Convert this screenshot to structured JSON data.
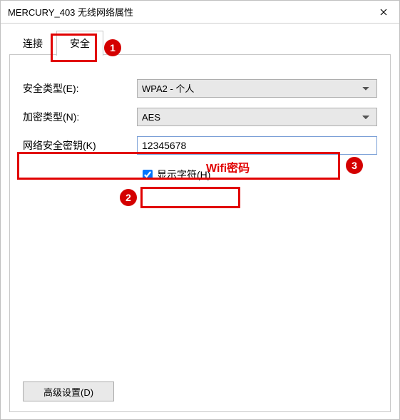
{
  "titlebar": {
    "title": "MERCURY_403 无线网络属性"
  },
  "tabs": {
    "connect": "连接",
    "security": "安全"
  },
  "form": {
    "security_type_label": "安全类型(E):",
    "security_type_value": "WPA2 - 个人",
    "encryption_label": "加密类型(N):",
    "encryption_value": "AES",
    "key_label": "网络安全密钥(K)",
    "key_value": "12345678",
    "show_chars_label": "显示字符(H)"
  },
  "buttons": {
    "advanced": "高级设置(D)"
  },
  "annotations": {
    "n1": "1",
    "n2": "2",
    "n3": "3",
    "wifi_pw": "Wifi密码"
  }
}
